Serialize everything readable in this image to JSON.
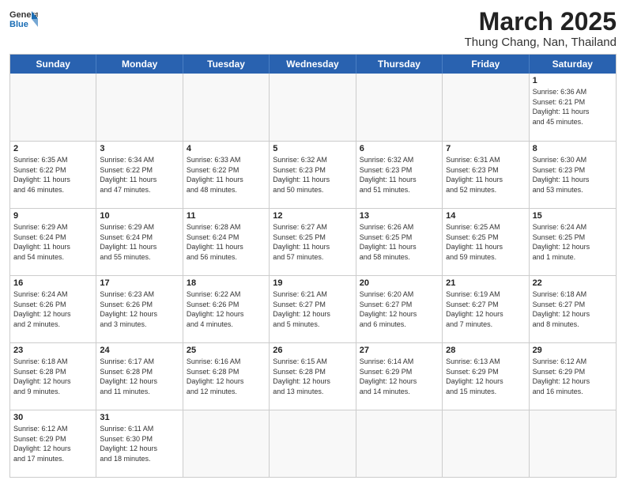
{
  "logo": {
    "general": "General",
    "blue": "Blue"
  },
  "title": "March 2025",
  "location": "Thung Chang, Nan, Thailand",
  "days_of_week": [
    "Sunday",
    "Monday",
    "Tuesday",
    "Wednesday",
    "Thursday",
    "Friday",
    "Saturday"
  ],
  "weeks": [
    [
      {
        "day": "",
        "empty": true,
        "info": ""
      },
      {
        "day": "",
        "empty": true,
        "info": ""
      },
      {
        "day": "",
        "empty": true,
        "info": ""
      },
      {
        "day": "",
        "empty": true,
        "info": ""
      },
      {
        "day": "",
        "empty": true,
        "info": ""
      },
      {
        "day": "",
        "empty": true,
        "info": ""
      },
      {
        "day": "1",
        "empty": false,
        "info": "Sunrise: 6:36 AM\nSunset: 6:21 PM\nDaylight: 11 hours\nand 45 minutes."
      }
    ],
    [
      {
        "day": "2",
        "empty": false,
        "info": "Sunrise: 6:35 AM\nSunset: 6:22 PM\nDaylight: 11 hours\nand 46 minutes."
      },
      {
        "day": "3",
        "empty": false,
        "info": "Sunrise: 6:34 AM\nSunset: 6:22 PM\nDaylight: 11 hours\nand 47 minutes."
      },
      {
        "day": "4",
        "empty": false,
        "info": "Sunrise: 6:33 AM\nSunset: 6:22 PM\nDaylight: 11 hours\nand 48 minutes."
      },
      {
        "day": "5",
        "empty": false,
        "info": "Sunrise: 6:32 AM\nSunset: 6:23 PM\nDaylight: 11 hours\nand 50 minutes."
      },
      {
        "day": "6",
        "empty": false,
        "info": "Sunrise: 6:32 AM\nSunset: 6:23 PM\nDaylight: 11 hours\nand 51 minutes."
      },
      {
        "day": "7",
        "empty": false,
        "info": "Sunrise: 6:31 AM\nSunset: 6:23 PM\nDaylight: 11 hours\nand 52 minutes."
      },
      {
        "day": "8",
        "empty": false,
        "info": "Sunrise: 6:30 AM\nSunset: 6:23 PM\nDaylight: 11 hours\nand 53 minutes."
      }
    ],
    [
      {
        "day": "9",
        "empty": false,
        "info": "Sunrise: 6:29 AM\nSunset: 6:24 PM\nDaylight: 11 hours\nand 54 minutes."
      },
      {
        "day": "10",
        "empty": false,
        "info": "Sunrise: 6:29 AM\nSunset: 6:24 PM\nDaylight: 11 hours\nand 55 minutes."
      },
      {
        "day": "11",
        "empty": false,
        "info": "Sunrise: 6:28 AM\nSunset: 6:24 PM\nDaylight: 11 hours\nand 56 minutes."
      },
      {
        "day": "12",
        "empty": false,
        "info": "Sunrise: 6:27 AM\nSunset: 6:25 PM\nDaylight: 11 hours\nand 57 minutes."
      },
      {
        "day": "13",
        "empty": false,
        "info": "Sunrise: 6:26 AM\nSunset: 6:25 PM\nDaylight: 11 hours\nand 58 minutes."
      },
      {
        "day": "14",
        "empty": false,
        "info": "Sunrise: 6:25 AM\nSunset: 6:25 PM\nDaylight: 11 hours\nand 59 minutes."
      },
      {
        "day": "15",
        "empty": false,
        "info": "Sunrise: 6:24 AM\nSunset: 6:25 PM\nDaylight: 12 hours\nand 1 minute."
      }
    ],
    [
      {
        "day": "16",
        "empty": false,
        "info": "Sunrise: 6:24 AM\nSunset: 6:26 PM\nDaylight: 12 hours\nand 2 minutes."
      },
      {
        "day": "17",
        "empty": false,
        "info": "Sunrise: 6:23 AM\nSunset: 6:26 PM\nDaylight: 12 hours\nand 3 minutes."
      },
      {
        "day": "18",
        "empty": false,
        "info": "Sunrise: 6:22 AM\nSunset: 6:26 PM\nDaylight: 12 hours\nand 4 minutes."
      },
      {
        "day": "19",
        "empty": false,
        "info": "Sunrise: 6:21 AM\nSunset: 6:27 PM\nDaylight: 12 hours\nand 5 minutes."
      },
      {
        "day": "20",
        "empty": false,
        "info": "Sunrise: 6:20 AM\nSunset: 6:27 PM\nDaylight: 12 hours\nand 6 minutes."
      },
      {
        "day": "21",
        "empty": false,
        "info": "Sunrise: 6:19 AM\nSunset: 6:27 PM\nDaylight: 12 hours\nand 7 minutes."
      },
      {
        "day": "22",
        "empty": false,
        "info": "Sunrise: 6:18 AM\nSunset: 6:27 PM\nDaylight: 12 hours\nand 8 minutes."
      }
    ],
    [
      {
        "day": "23",
        "empty": false,
        "info": "Sunrise: 6:18 AM\nSunset: 6:28 PM\nDaylight: 12 hours\nand 9 minutes."
      },
      {
        "day": "24",
        "empty": false,
        "info": "Sunrise: 6:17 AM\nSunset: 6:28 PM\nDaylight: 12 hours\nand 11 minutes."
      },
      {
        "day": "25",
        "empty": false,
        "info": "Sunrise: 6:16 AM\nSunset: 6:28 PM\nDaylight: 12 hours\nand 12 minutes."
      },
      {
        "day": "26",
        "empty": false,
        "info": "Sunrise: 6:15 AM\nSunset: 6:28 PM\nDaylight: 12 hours\nand 13 minutes."
      },
      {
        "day": "27",
        "empty": false,
        "info": "Sunrise: 6:14 AM\nSunset: 6:29 PM\nDaylight: 12 hours\nand 14 minutes."
      },
      {
        "day": "28",
        "empty": false,
        "info": "Sunrise: 6:13 AM\nSunset: 6:29 PM\nDaylight: 12 hours\nand 15 minutes."
      },
      {
        "day": "29",
        "empty": false,
        "info": "Sunrise: 6:12 AM\nSunset: 6:29 PM\nDaylight: 12 hours\nand 16 minutes."
      }
    ],
    [
      {
        "day": "30",
        "empty": false,
        "info": "Sunrise: 6:12 AM\nSunset: 6:29 PM\nDaylight: 12 hours\nand 17 minutes."
      },
      {
        "day": "31",
        "empty": false,
        "info": "Sunrise: 6:11 AM\nSunset: 6:30 PM\nDaylight: 12 hours\nand 18 minutes."
      },
      {
        "day": "",
        "empty": true,
        "info": ""
      },
      {
        "day": "",
        "empty": true,
        "info": ""
      },
      {
        "day": "",
        "empty": true,
        "info": ""
      },
      {
        "day": "",
        "empty": true,
        "info": ""
      },
      {
        "day": "",
        "empty": true,
        "info": ""
      }
    ]
  ]
}
